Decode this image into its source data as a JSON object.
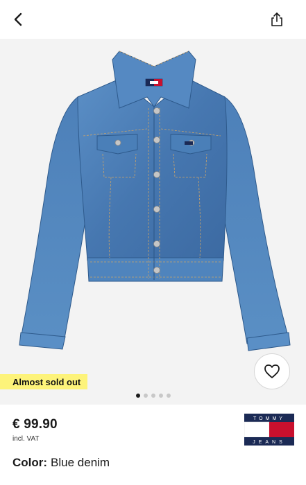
{
  "navigation": {
    "back_icon": "chevron-left-icon",
    "share_icon": "share-icon"
  },
  "gallery": {
    "image_subject": "blue denim jacket",
    "badge": "Almost sold out",
    "wishlist_icon": "heart-outline-icon",
    "dot_count": 5,
    "active_dot": 0
  },
  "product": {
    "price": "€ 99.90",
    "vat_note": "incl. VAT",
    "color_label": "Color:",
    "color_value": "Blue denim"
  },
  "brand": {
    "logo_top_text": "TOMMY",
    "logo_bottom_text": "JEANS",
    "colors": {
      "navy": "#1b2a55",
      "red": "#c8102e",
      "white": "#ffffff"
    }
  },
  "colors": {
    "badge_bg": "#fdf37a",
    "gallery_bg": "#f3f3f3",
    "denim": "#4a7fb8"
  }
}
